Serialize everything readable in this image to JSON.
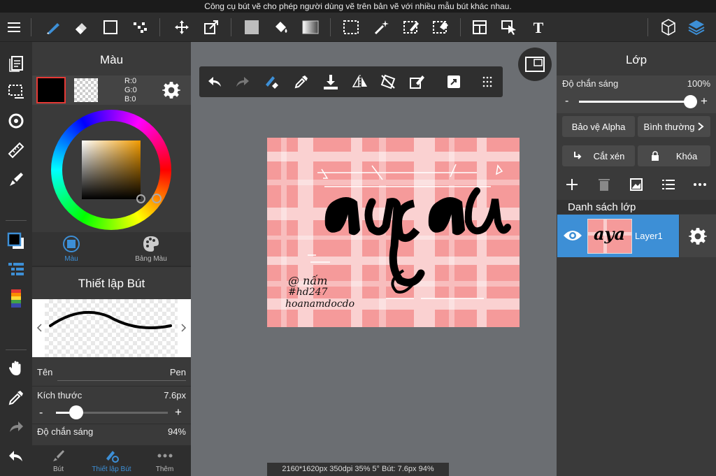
{
  "tooltip": "Công cụ bút vẽ cho phép người dùng vẽ trên bản vẽ với nhiều mẫu bút khác nhau.",
  "toolbar": {
    "icons": [
      "menu-icon",
      "pen-icon",
      "eraser-icon",
      "rectangle-icon",
      "dot-pen-icon",
      "move-icon",
      "transform-icon",
      "fill-color-icon",
      "bucket-icon",
      "gradient-icon",
      "rect-select-icon",
      "magic-wand-icon",
      "select-pen-icon",
      "select-eraser-icon",
      "layout-icon",
      "operation-icon",
      "text-icon",
      "3d-icon",
      "layers-icon"
    ]
  },
  "color_panel": {
    "title": "Màu",
    "rgb": {
      "r": "R:0",
      "g": "G:0",
      "b": "B:0"
    },
    "primary_color": "#000000",
    "tabs": [
      {
        "label": "Màu",
        "active": true
      },
      {
        "label": "Bảng Màu",
        "active": false
      }
    ]
  },
  "pen_panel": {
    "title": "Thiết lập Bút",
    "name_label": "Tên",
    "name_value": "Pen",
    "size_label": "Kích thước",
    "size_value": "7.6px",
    "size_fraction": 0.12,
    "opacity_label": "Độ chắn sáng",
    "opacity_value": "94%"
  },
  "bottom_tabs": [
    {
      "label": "Bút",
      "active": false
    },
    {
      "label": "Thiết lập Bút",
      "active": true
    },
    {
      "label": "Thêm",
      "active": false
    }
  ],
  "artwork": {
    "title_text": "aya",
    "signature_line1": "@ nấm",
    "signature_line2": "#hd247",
    "signature_line3": "hoanamdocdo"
  },
  "status": "2160*1620px 350dpi 35% 5° Bút: 7.6px 94%",
  "layer_panel": {
    "title": "Lớp",
    "opacity_label": "Độ chắn sáng",
    "opacity_value": "100%",
    "opacity_fraction": 1.0,
    "alpha_protect": "Bảo vệ Alpha",
    "blend_mode": "Bình thường",
    "clip": "Cắt xén",
    "lock": "Khóa",
    "list_title": "Danh sách lớp",
    "layers": [
      {
        "name": "Layer1",
        "thumb_text": "aya"
      }
    ]
  },
  "colors": {
    "accent": "#3d8fd6",
    "panel_bg": "#3a3a3a",
    "canvas_bg": "#6b6e72",
    "artwork_bg": "#f59a9a"
  }
}
